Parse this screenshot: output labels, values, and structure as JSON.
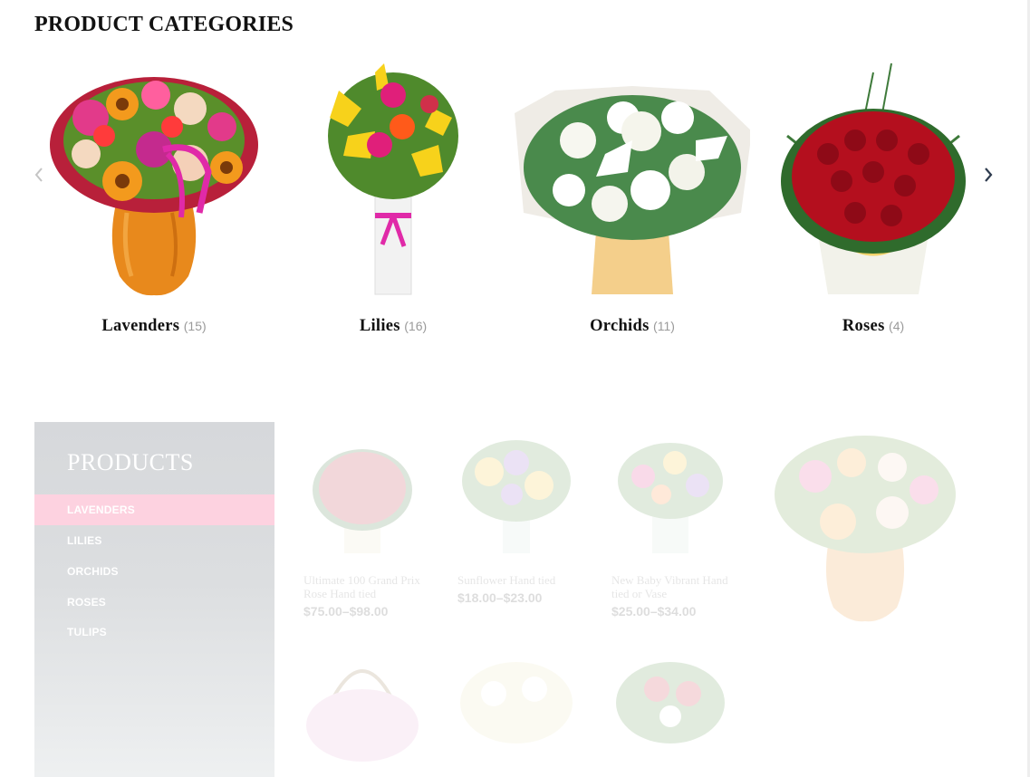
{
  "section": {
    "title": "PRODUCT CATEGORIES"
  },
  "carousel": {
    "prev_icon": "chevron-left-icon",
    "next_icon": "chevron-right-icon",
    "categories": [
      {
        "name": "Lavenders",
        "count": "(15)",
        "image": "mixed-bouquet-in-orange-vase"
      },
      {
        "name": "Lilies",
        "count": "(16)",
        "image": "yellow-lily-bouquet-in-white-vase"
      },
      {
        "name": "Orchids",
        "count": "(11)",
        "image": "white-rose-and-lily-bouquet"
      },
      {
        "name": "Roses",
        "count": "(4)",
        "image": "red-rose-bouquet"
      }
    ]
  },
  "sidebar": {
    "title": "PRODUCTS",
    "items": [
      {
        "label": "LAVENDERS",
        "active": true
      },
      {
        "label": "LILIES",
        "active": false
      },
      {
        "label": "ORCHIDS",
        "active": false
      },
      {
        "label": "ROSES",
        "active": false
      },
      {
        "label": "TULIPS",
        "active": false
      }
    ]
  },
  "products": [
    {
      "name": "Ultimate 100 Grand Prix Rose Hand tied",
      "price": "$75.00–$98.00",
      "image": "red-rose-bouquet"
    },
    {
      "name": "Sunflower Hand tied",
      "price": "$18.00–$23.00",
      "image": "sunflower-bouquet"
    },
    {
      "name": "New Baby Vibrant Hand tied or Vase",
      "price": "$25.00–$34.00",
      "image": "bright-mixed-bouquet"
    },
    {
      "name": "",
      "price": "",
      "image": "pink-flower-basket"
    },
    {
      "name": "",
      "price": "",
      "image": "white-flower-basket"
    },
    {
      "name": "",
      "price": "",
      "image": "red-and-white-bouquet"
    }
  ],
  "featured_image": "mixed-bouquet-in-orange-vase",
  "colors": {
    "accent_pink": "#fdd2e0",
    "sidebar_gray": "#d6d8db",
    "arrow": "#2e3b4e"
  }
}
